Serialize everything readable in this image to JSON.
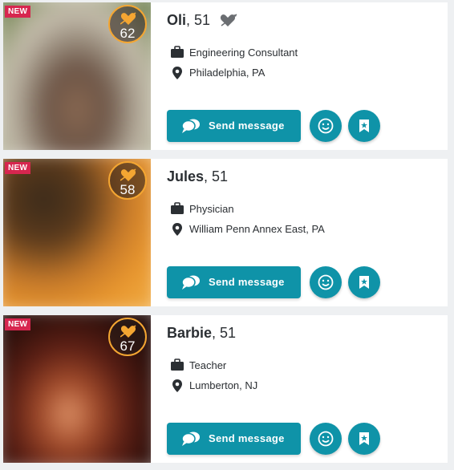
{
  "colors": {
    "accent": "#0f93a8",
    "new_badge": "#d7264f",
    "match_ring": "#f4a632"
  },
  "profiles": [
    {
      "badge": "NEW",
      "match": "62",
      "name": "Oli",
      "age_text": ", 51",
      "favorited": true,
      "occupation": "Engineering Consultant",
      "location": "Philadelphia, PA",
      "send_label": "Send message"
    },
    {
      "badge": "NEW",
      "match": "58",
      "name": "Jules",
      "age_text": ", 51",
      "favorited": false,
      "occupation": "Physician",
      "location": "William Penn Annex East, PA",
      "send_label": "Send message"
    },
    {
      "badge": "NEW",
      "match": "67",
      "name": "Barbie",
      "age_text": ", 51",
      "favorited": false,
      "occupation": "Teacher",
      "location": "Lumberton, NJ",
      "send_label": "Send message"
    }
  ]
}
